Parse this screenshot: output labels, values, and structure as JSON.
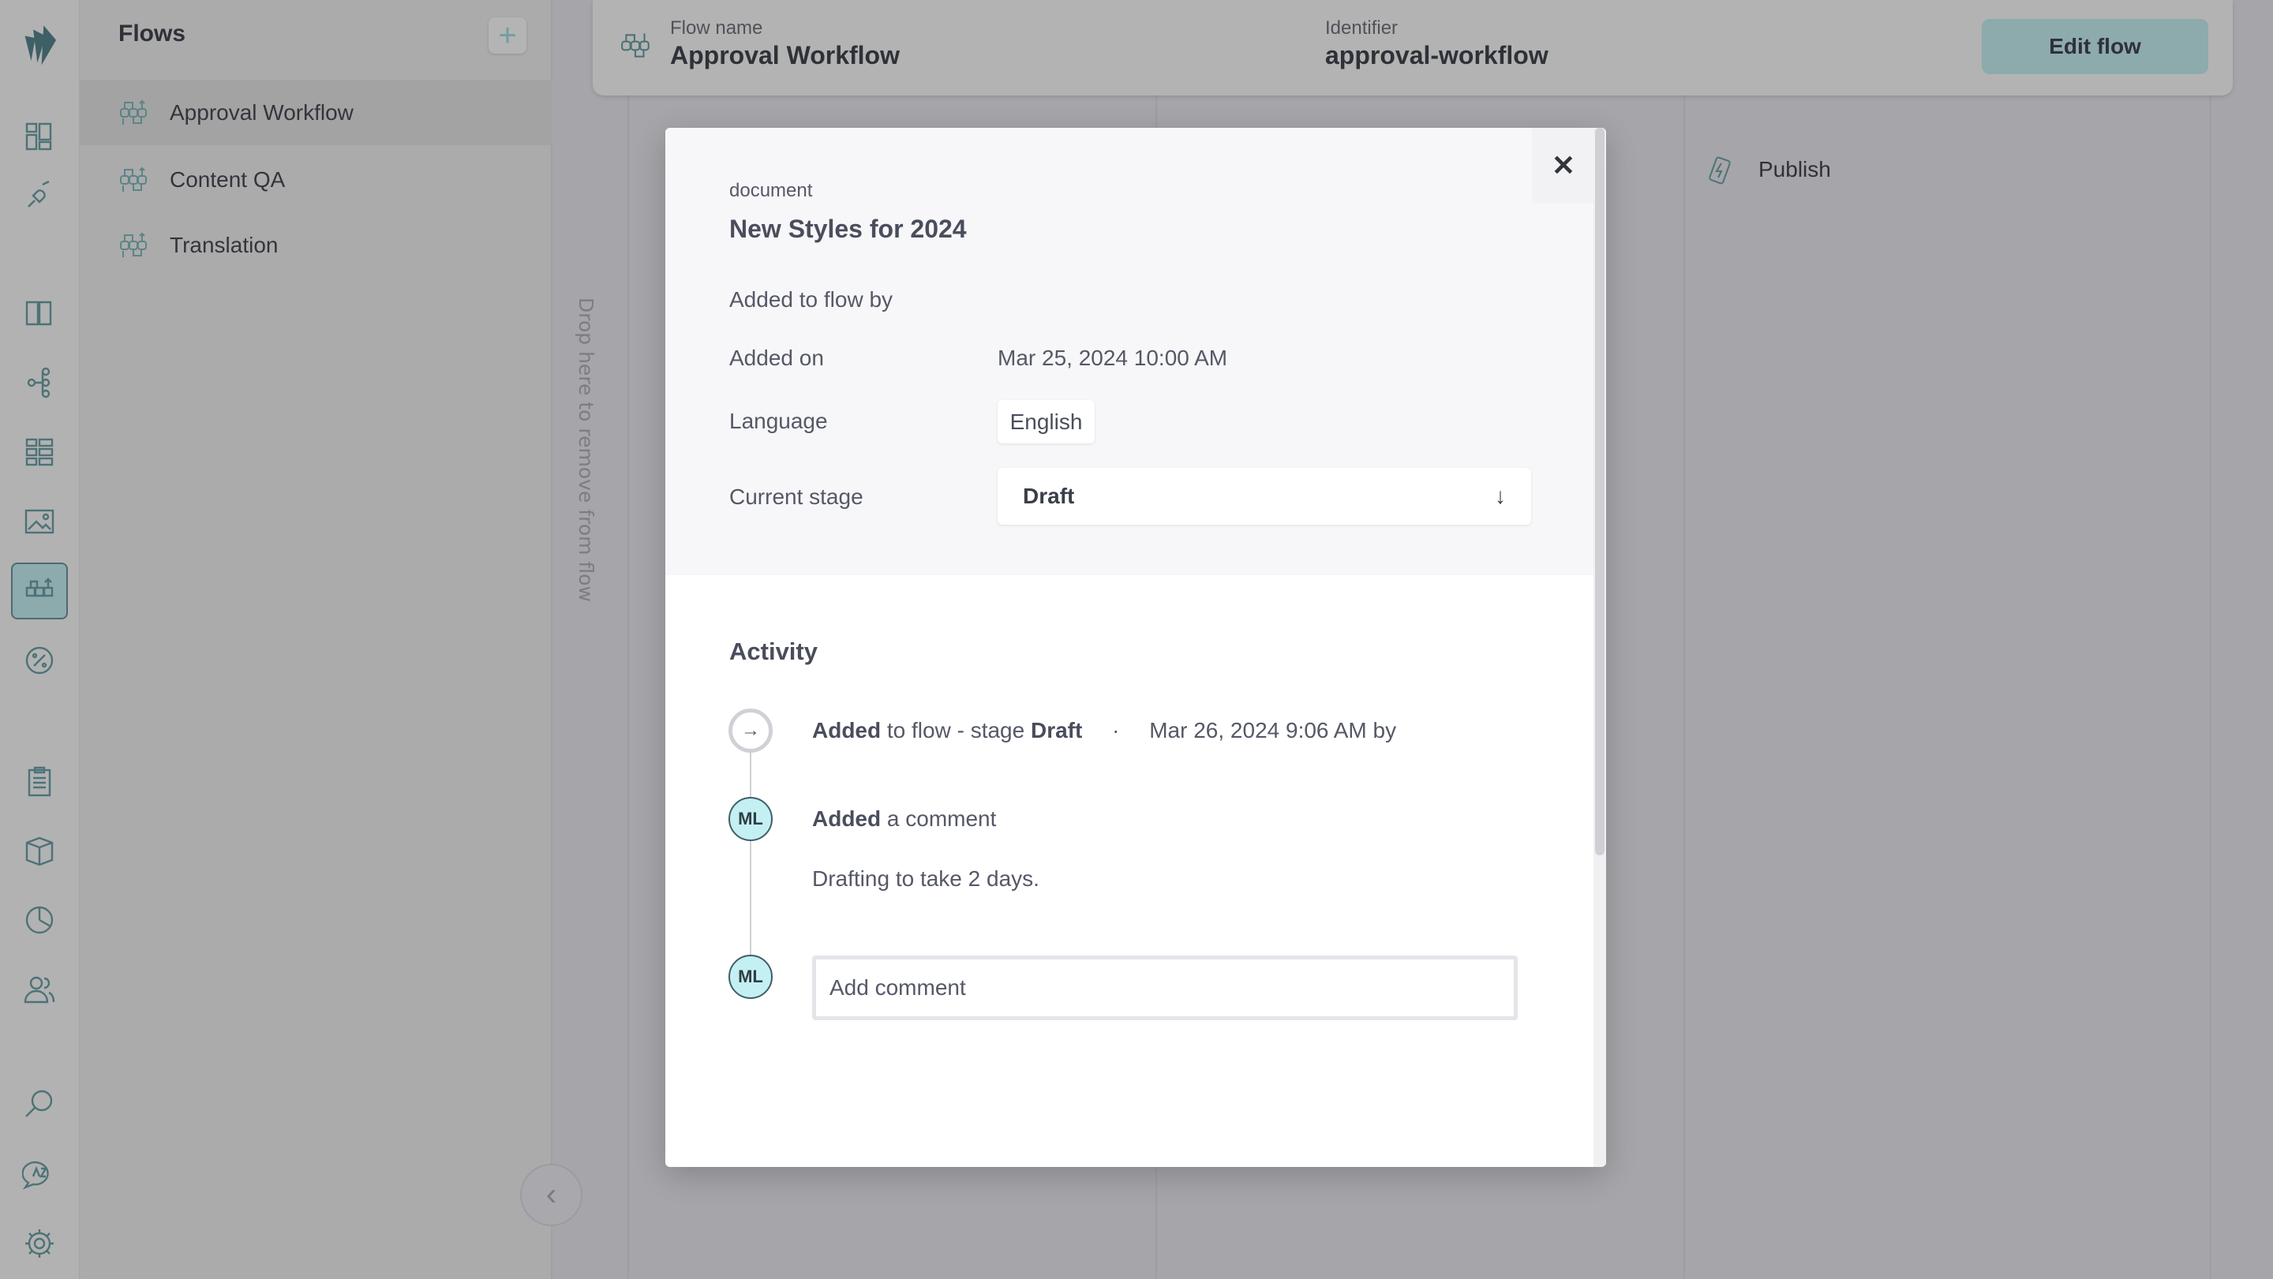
{
  "rail": {
    "items": [
      "logo",
      "dashboard-icon",
      "plug-icon",
      "book-icon",
      "tree-icon",
      "grid-icon",
      "image-icon",
      "flows-icon",
      "percent-icon",
      "clipboard-icon",
      "box-icon",
      "chart-icon",
      "users-icon",
      "search-icon",
      "translate-icon",
      "gear-icon"
    ],
    "active": "flows-icon"
  },
  "flows": {
    "title": "Flows",
    "items": [
      {
        "label": "Approval Workflow",
        "selected": true
      },
      {
        "label": "Content QA"
      },
      {
        "label": "Translation"
      }
    ]
  },
  "header": {
    "flow_name_label": "Flow name",
    "flow_name": "Approval Workflow",
    "identifier_label": "Identifier",
    "identifier": "approval-workflow",
    "edit_button": "Edit flow"
  },
  "board": {
    "drop_text": "Drop here to remove from flow",
    "stage_publish": "Publish"
  },
  "modal": {
    "type": "document",
    "title": "New Styles for 2024",
    "added_by_label": "Added to flow by",
    "added_on_label": "Added on",
    "added_on": "Mar 25, 2024 10:00 AM",
    "language_label": "Language",
    "language": "English",
    "stage_label": "Current stage",
    "stage": "Draft",
    "activity_title": "Activity",
    "activity": [
      {
        "bold": "Added",
        "text": " to flow - stage ",
        "bold2": "Draft",
        "sep": "·",
        "time": "Mar 26, 2024 9:06 AM by"
      },
      {
        "avatar": "ML",
        "bold": "Added",
        "text": " a comment",
        "comment": "Drafting to take 2 days."
      }
    ],
    "composer": {
      "avatar": "ML",
      "placeholder": "Add comment"
    }
  },
  "colors": {
    "accent": "#8daaad",
    "avatar_bg": "#c4f0f3"
  }
}
